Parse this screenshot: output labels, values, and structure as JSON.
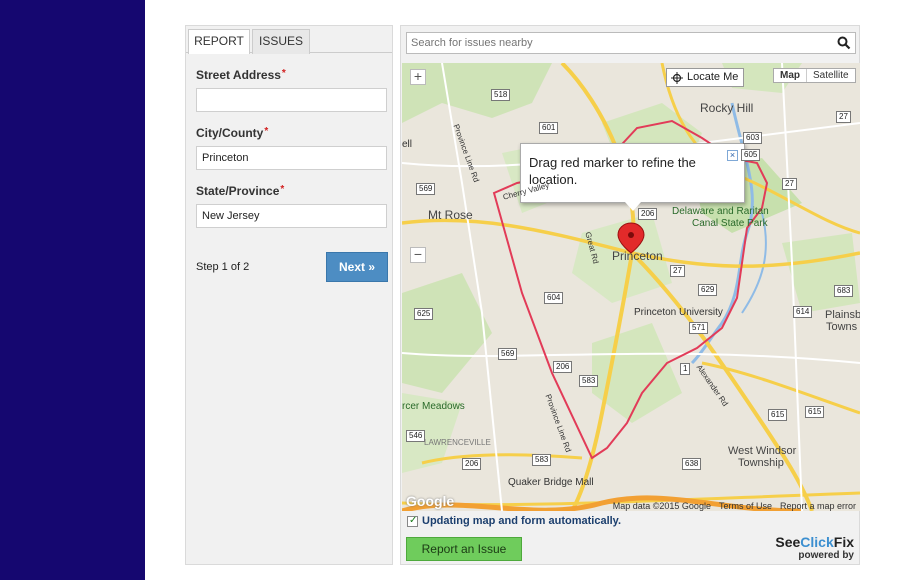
{
  "colors": {
    "left_band": "#150770",
    "next_button": "#4d8dc3",
    "report_button": "#6fcc5c",
    "boundary": "#e23b58",
    "required": "#d21f1f"
  },
  "tabs": [
    {
      "label": "REPORT",
      "active": true
    },
    {
      "label": "ISSUES",
      "active": false
    }
  ],
  "form": {
    "street": {
      "label": "Street Address",
      "required_mark": "*",
      "value": ""
    },
    "city": {
      "label": "City/County",
      "required_mark": "*",
      "value": "Princeton"
    },
    "state": {
      "label": "State/Province",
      "required_mark": "*",
      "value": "New Jersey"
    },
    "step_text": "Step 1 of 2",
    "next_label": "Next »"
  },
  "map": {
    "search_placeholder": "Search for issues nearby",
    "locate_label": "Locate Me",
    "type_map": "Map",
    "type_satellite": "Satellite",
    "zoom_in": "+",
    "zoom_out": "−",
    "tooltip": "Drag red marker to refine the location.",
    "tooltip_close": "×",
    "google": "Google",
    "attribution": "Map data ©2015 Google",
    "terms": "Terms of Use",
    "report_error": "Report a map error",
    "places": {
      "rocky_hill": "Rocky Hill",
      "mt_rose": "Mt Rose",
      "princeton": "Princeton",
      "princeton_university": "Princeton University",
      "delaware_raritan": "Delaware and Raritan",
      "canal_state_park": "Canal State Park",
      "plainsboro": "Plainsb",
      "plainsboro2": "Towns",
      "mercer_meadows": "rcer Meadows",
      "lawrenceville": "LAWRENCEVILLE",
      "quaker_bridge": "Quaker Bridge Mall",
      "west_windsor": "West Windsor",
      "township": "Township",
      "province_line": "Province Line Rd",
      "province_line2": "Province Line Rd",
      "great_rd": "Great Rd",
      "cherry_valley": "Cherry Valley",
      "alexander": "Alexander Rd",
      "ell": "ell"
    },
    "shields": {
      "s518": "518",
      "s601": "601",
      "s603": "603",
      "s605": "605",
      "s27a": "27",
      "s27b": "27",
      "s569a": "569",
      "s206a": "206",
      "s27c": "27",
      "s629": "629",
      "s604": "604",
      "s625": "625",
      "s571": "571",
      "s569b": "569",
      "s206b": "206",
      "s583a": "583",
      "s1": "1",
      "s614": "614",
      "s683": "683",
      "s615a": "615",
      "s615b": "615",
      "s546": "546",
      "s206c": "206",
      "s583b": "583",
      "s638": "638"
    }
  },
  "footer": {
    "auto_update": "Updating map and form automatically.",
    "report_button": "Report an Issue",
    "brand_see": "See",
    "brand_click": "Click",
    "brand_fix": "Fix",
    "brand_powered": "powered by"
  }
}
